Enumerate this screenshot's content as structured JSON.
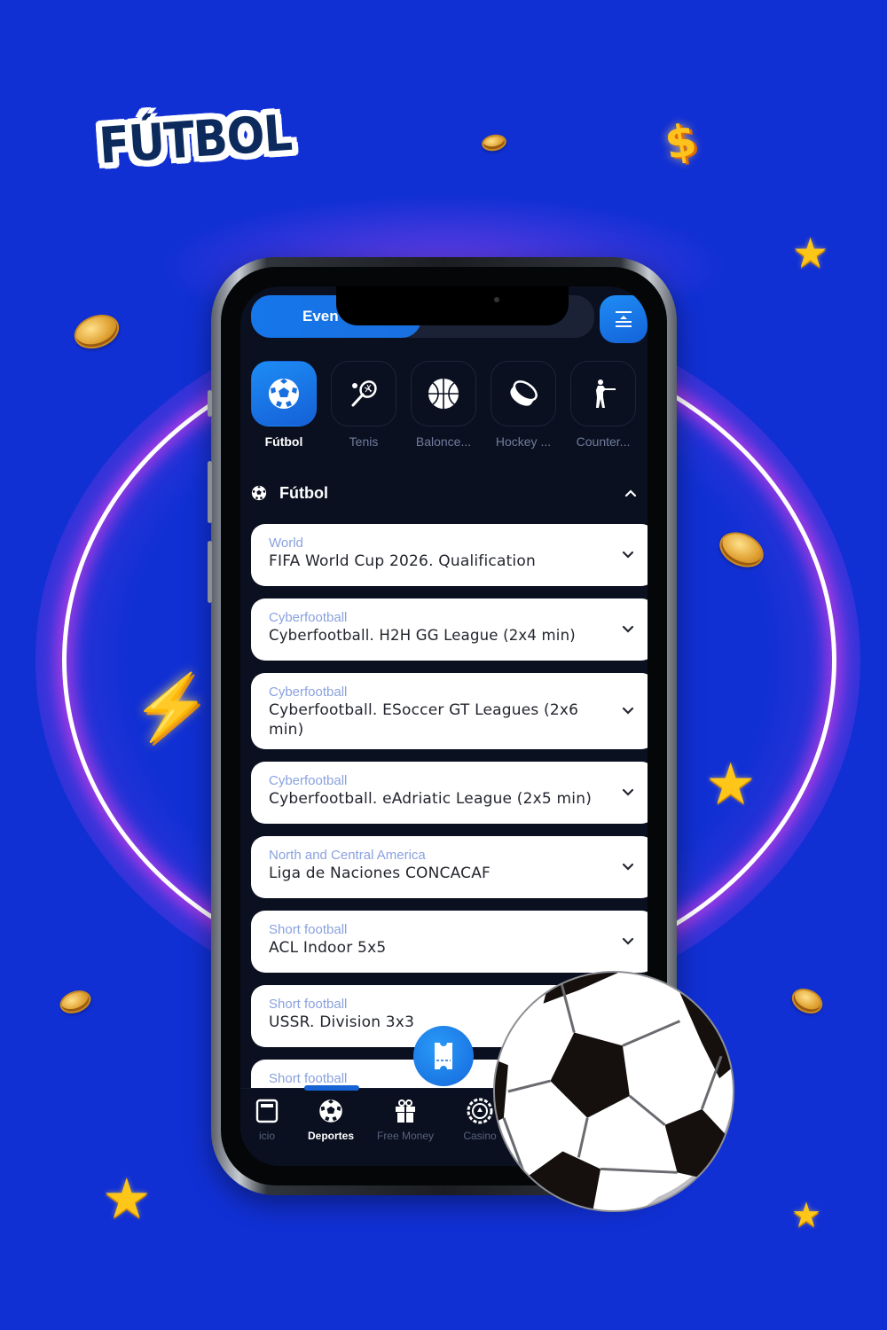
{
  "poster": {
    "title": "FÚTBOL",
    "decorations": [
      "coin-icon",
      "dollar-icon",
      "star-icon",
      "lightning-icon",
      "soccer-ball-icon"
    ],
    "colors": {
      "background": "#1130d4",
      "ring": "#ffffff",
      "ring_glow": "#be3ce6",
      "title_text": "#0d2a5c"
    }
  },
  "app": {
    "top_segment": {
      "active_label": "Eventos",
      "active_visible": "Even",
      "inactive_label": "",
      "collapse_icon": "collapse-icon"
    },
    "sports": [
      {
        "label": "Fútbol",
        "icon": "soccer-icon",
        "active": true
      },
      {
        "label": "Tenis",
        "icon": "tennis-icon",
        "active": false
      },
      {
        "label": "Balonce...",
        "icon": "basketball-icon",
        "active": false
      },
      {
        "label": "Hockey ...",
        "icon": "hockey-puck-icon",
        "active": false
      },
      {
        "label": "Counter...",
        "icon": "counter-strike-icon",
        "active": false
      }
    ],
    "section": {
      "title": "Fútbol",
      "expanded": true
    },
    "leagues": [
      {
        "category": "World",
        "name": "FIFA World Cup 2026. Qualification"
      },
      {
        "category": "Cyberfootball",
        "name": "Cyberfootball. H2H GG League (2x4 min)"
      },
      {
        "category": "Cyberfootball",
        "name": "Cyberfootball. ESoccer GT Leagues (2x6 min)"
      },
      {
        "category": "Cyberfootball",
        "name": "Cyberfootball. eAdriatic League (2x5 min)"
      },
      {
        "category": "North and Central America",
        "name": "Liga de Naciones CONCACAF"
      },
      {
        "category": "Short football",
        "name": "ACL Indoor 5x5"
      },
      {
        "category": "Short football",
        "name": "USSR. Division 3x3"
      },
      {
        "category": "Short football",
        "name": ""
      }
    ],
    "bet_slip_icon": "ticket-icon",
    "tabbar": [
      {
        "label": "Inicio",
        "visible_label": "icio",
        "icon": "home-icon",
        "active": false
      },
      {
        "label": "Deportes",
        "icon": "soccer-icon",
        "active": true
      },
      {
        "label": "Free Money",
        "icon": "gift-icon",
        "active": false
      },
      {
        "label": "Casino",
        "icon": "casino-chip-icon",
        "active": false
      }
    ],
    "colors": {
      "accent": "#1577ea",
      "screen_bg": "#0b1020",
      "card_bg": "#ffffff",
      "category_text": "#8aa2de",
      "inactive_text": "#6f7c9c"
    }
  }
}
